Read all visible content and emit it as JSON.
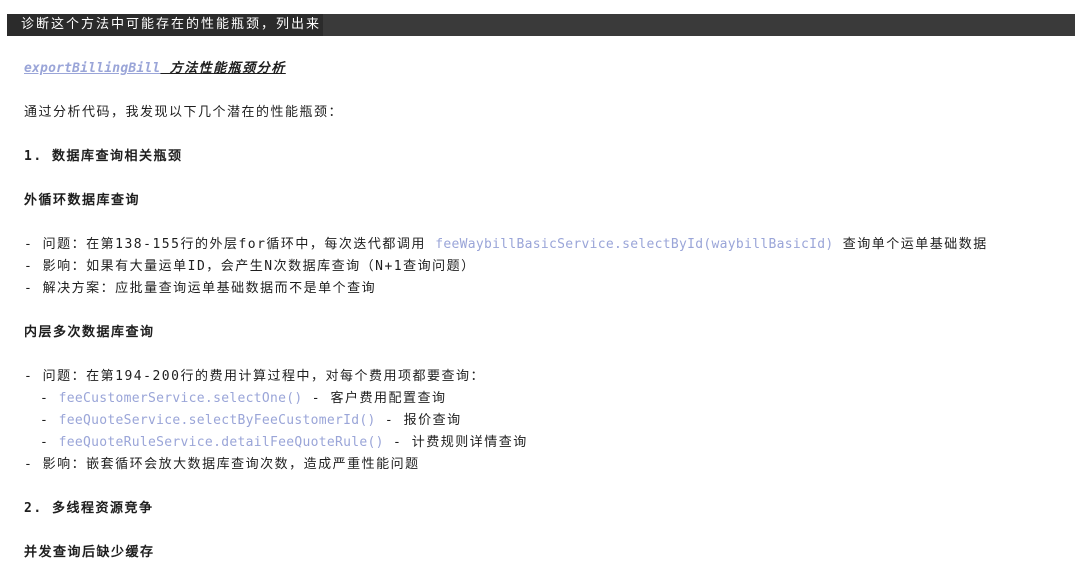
{
  "prompt": {
    "text": "诊断这个方法中可能存在的性能瓶颈，列出来"
  },
  "response": {
    "title_code": "exportBillingBill",
    "title_text": " 方法性能瓶颈分析",
    "intro": "通过分析代码，我发现以下几个潜在的性能瓶颈：",
    "section1_heading": "1. 数据库查询相关瓶颈",
    "sub1_heading": "外循环数据库查询",
    "sub1_problem_prefix": "- 问题：在第138-155行的外层for循环中，每次迭代都调用 ",
    "sub1_problem_code": "feeWaybillBasicService.selectById(waybillBasicId)",
    "sub1_problem_suffix": " 查询单个运单基础数据",
    "sub1_impact": "- 影响：如果有大量运单ID，会产生N次数据库查询（N+1查询问题）",
    "sub1_solution": "- 解决方案：应批量查询运单基础数据而不是单个查询",
    "sub2_heading": "内层多次数据库查询",
    "sub2_problem": "- 问题：在第194-200行的费用计算过程中，对每个费用项都要查询：",
    "sub2_items": [
      {
        "prefix": "- ",
        "code": "feeCustomerService.selectOne()",
        "suffix": " - 客户费用配置查询"
      },
      {
        "prefix": "- ",
        "code": "feeQuoteService.selectByFeeCustomerId()",
        "suffix": " - 报价查询"
      },
      {
        "prefix": "- ",
        "code": "feeQuoteRuleService.detailFeeQuoteRule()",
        "suffix": " - 计费规则详情查询"
      }
    ],
    "sub2_impact": "- 影响：嵌套循环会放大数据库查询次数，造成严重性能问题",
    "section2_heading": "2. 多线程资源竞争",
    "sub3_heading": "并发查询后缺少缓存"
  },
  "colors": {
    "code": "#9aa5d8",
    "prompt_bg": "#2b2b2b",
    "prompt_bar": "#3a3a3a",
    "text": "#1e1e1e"
  }
}
